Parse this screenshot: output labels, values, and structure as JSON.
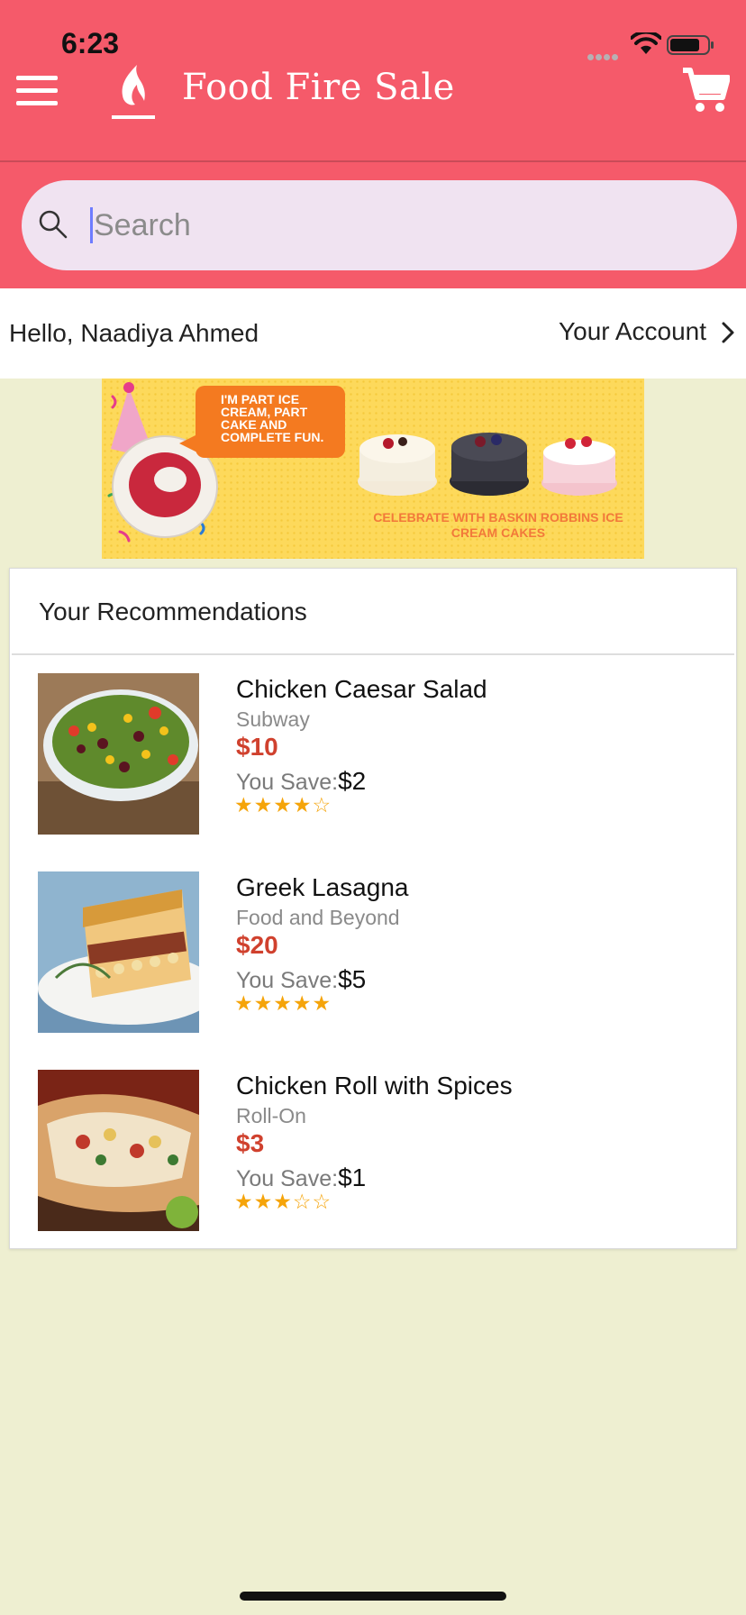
{
  "status_bar": {
    "time": "6:23"
  },
  "header": {
    "app_title": "Food Fire Sale",
    "menu_icon": "hamburger-menu-icon",
    "logo_icon": "flame-logo-icon",
    "cart_icon": "shopping-cart-icon",
    "brand_color": "#f55a6a"
  },
  "search": {
    "placeholder": "Search",
    "value": "",
    "icon": "search-icon"
  },
  "account": {
    "greeting": "Hello, Naadiya Ahmed",
    "link_label": "Your Account",
    "chevron_icon": "chevron-right-icon"
  },
  "banner": {
    "bubble_text": "I'M PART ICE CREAM, PART CAKE AND COMPLETE FUN.",
    "tagline": "CELEBRATE WITH BASKIN ROBBINS ICE CREAM CAKES"
  },
  "recommendations": {
    "title": "Your Recommendations",
    "save_label": "You Save:",
    "items": [
      {
        "name": "Chicken Caesar Salad",
        "restaurant": "Subway",
        "price": "$10",
        "save": "$2",
        "stars": "★★★★☆",
        "rating": 4
      },
      {
        "name": "Greek Lasagna",
        "restaurant": "Food and Beyond",
        "price": "$20",
        "save": "$5",
        "stars": "★★★★★",
        "rating": 5
      },
      {
        "name": "Chicken Roll with Spices",
        "restaurant": "Roll-On",
        "price": "$3",
        "save": "$1",
        "stars": "★★★☆☆",
        "rating": 3
      }
    ]
  },
  "colors": {
    "background": "#eeefd1",
    "price": "#d0412e",
    "star": "#f5a40a"
  }
}
